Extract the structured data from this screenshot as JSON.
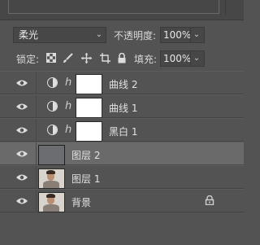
{
  "blend": {
    "mode": "柔光",
    "opacity_label": "不透明度:",
    "opacity_value": "100%"
  },
  "lock": {
    "label": "锁定:",
    "fill_label": "填充:",
    "fill_value": "100%"
  },
  "layers": [
    {
      "name": "曲线 2",
      "kind": "adjustment",
      "visible": true
    },
    {
      "name": "曲线 1",
      "kind": "adjustment",
      "visible": true
    },
    {
      "name": "黑白 1",
      "kind": "adjustment",
      "visible": true
    },
    {
      "name": "图层 2",
      "kind": "pixel-gray",
      "visible": false,
      "selected": true
    },
    {
      "name": "图层 1",
      "kind": "photo",
      "visible": true
    },
    {
      "name": "背景",
      "kind": "photo",
      "visible": true,
      "locked": true
    }
  ],
  "icons": {
    "eye": "eye-icon",
    "adjustment": "half-circle-adjustment-icon",
    "link": "chain-link-icon",
    "lock": "lock-icon"
  },
  "colors": {
    "panel_bg": "#535353",
    "selected_row": "#6a6a6a",
    "text": "#e2e2e2"
  }
}
